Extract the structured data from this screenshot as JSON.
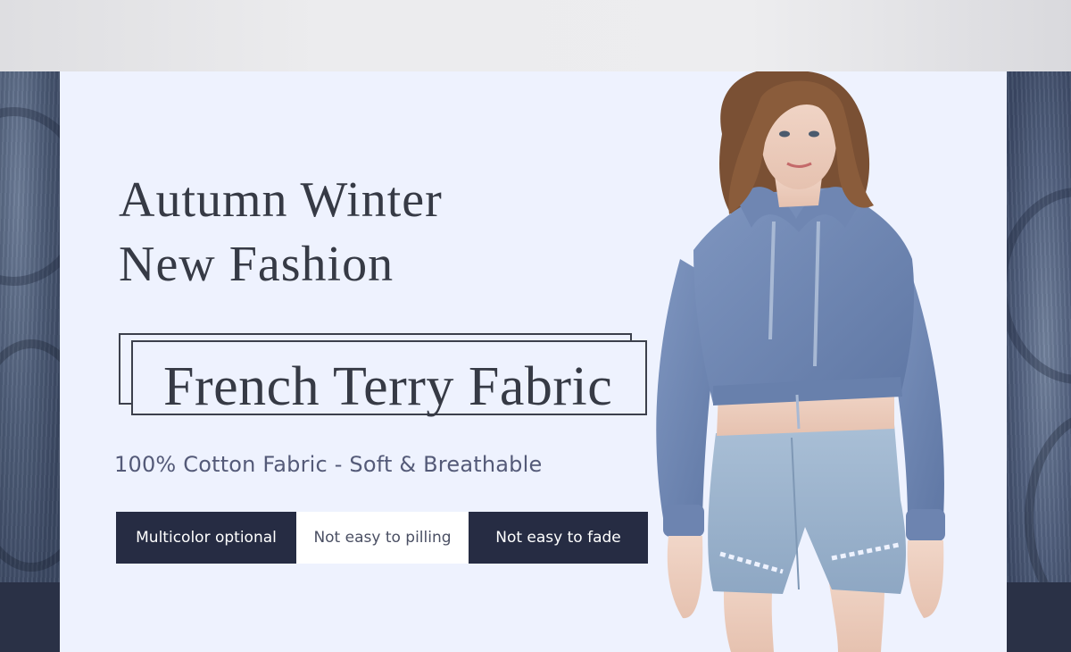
{
  "banner": {
    "headline_line1": "Autumn Winter",
    "headline_line2": "New Fashion",
    "badge_text": "French Terry Fabric",
    "subtitle": "100% Cotton Fabric - Soft & Breathable",
    "features": [
      "Multicolor optional",
      "Not easy to pilling",
      "Not easy to fade"
    ]
  },
  "colors": {
    "panel_background": "#eef2fe",
    "navy": "#262c43",
    "hoodie_blue": "#7189b6",
    "denim": "#9fb6cf",
    "heading_text": "#363a45"
  },
  "icons": {
    "model_photo": "model-wearing-blue-crop-hoodie-and-denim-shorts",
    "fabric_texture": "blue-knit-fabric-texture"
  }
}
